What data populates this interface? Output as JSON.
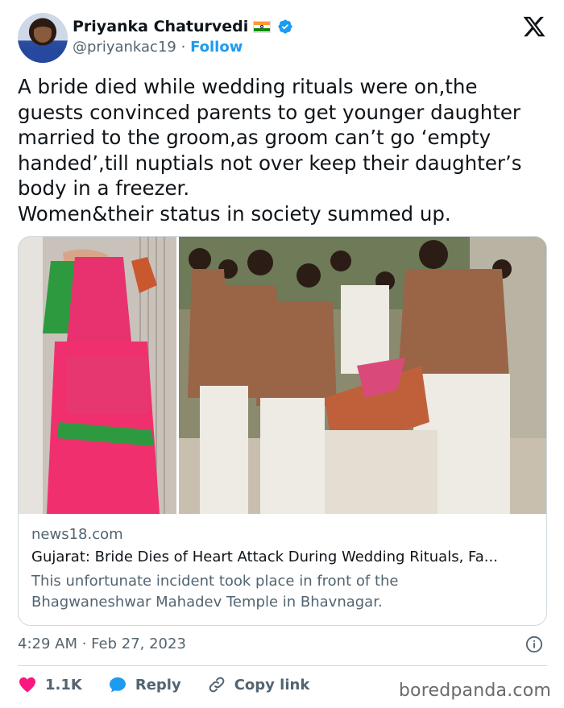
{
  "author": {
    "name": "Priyanka Chaturvedi",
    "handle": "@priyankac19",
    "separator": "·",
    "follow_label": "Follow",
    "verified_color": "#1d9bf0",
    "flag_colors": [
      "#ff9933",
      "#ffffff",
      "#138808"
    ]
  },
  "tweet": {
    "text": "A bride died while wedding rituals were on,the\nguests convinced parents to get younger daughter\nmarried to the groom,as groom can’t go ‘empty\nhanded’,till nuptials not over keep their daughter’s\nbody in a freezer.\nWomen&their status in society summed up."
  },
  "link_card": {
    "domain": "news18.com",
    "title": "Gujarat: Bride Dies of Heart Attack During Wedding Rituals, Fa...",
    "description": "This unfortunate incident took place in front of the\nBhagwaneshwar Mahadev Temple in Bhavnagar."
  },
  "meta": {
    "timestamp": "4:29 AM · Feb 27, 2023"
  },
  "actions": {
    "like_count": "1.1K",
    "reply_label": "Reply",
    "copy_link_label": "Copy link",
    "like_color": "#f91880",
    "reply_color": "#1d9bf0"
  },
  "watermark": "boredpanda.com"
}
